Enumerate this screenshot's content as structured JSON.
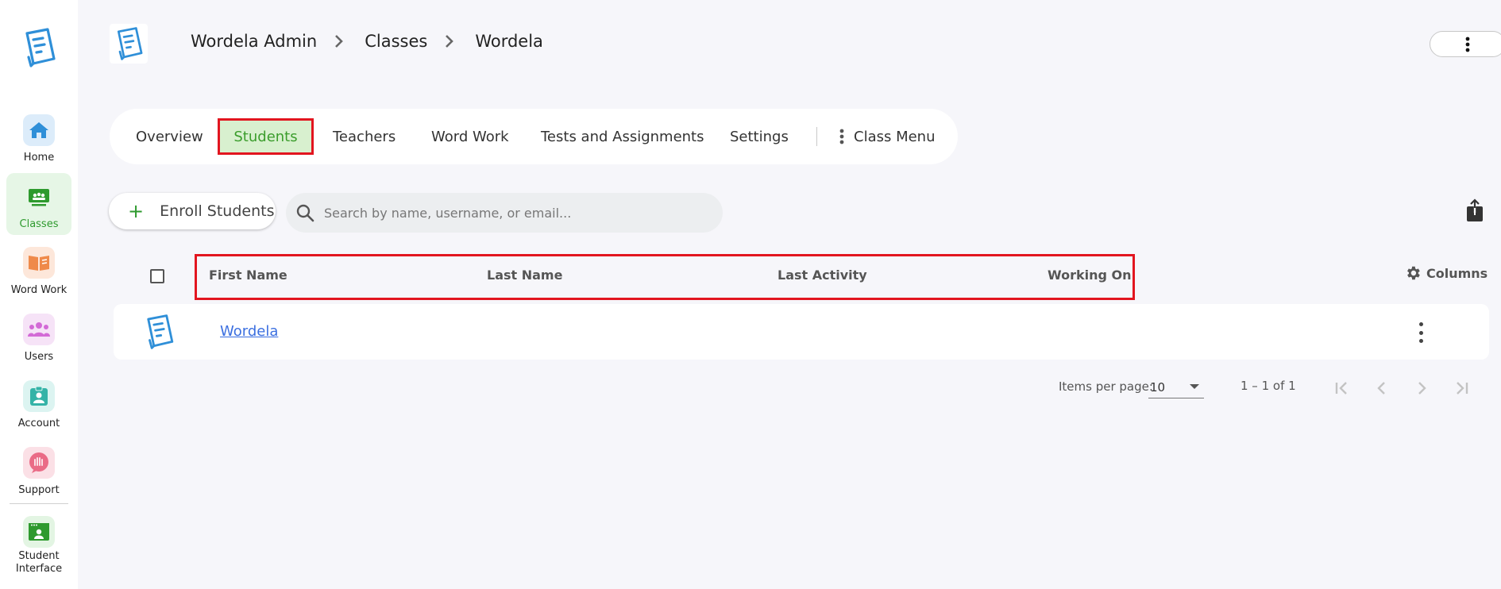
{
  "sidebar": {
    "items": [
      {
        "label": "Home",
        "icon": "home-icon",
        "color": "#2f8fd8",
        "bg": "#dcecfa"
      },
      {
        "label": "Classes",
        "icon": "classroom-icon",
        "color": "#2e9a2e",
        "bg": "#e6f6e6",
        "active": true
      },
      {
        "label": "Word Work",
        "icon": "book-icon",
        "color": "#ef8a4a",
        "bg": "#fde7da"
      },
      {
        "label": "Users",
        "icon": "users-icon",
        "color": "#d36ad6",
        "bg": "#f6e3f7"
      },
      {
        "label": "Account",
        "icon": "id-badge-icon",
        "color": "#34b3a7",
        "bg": "#dcf4f1"
      },
      {
        "label": "Support",
        "icon": "support-bubble-icon",
        "color": "#ea6b86",
        "bg": "#fbe0e6"
      },
      {
        "label": "Student Interface",
        "icon": "student-window-icon",
        "color": "#2e9a2e",
        "bg": "#e3f5e3"
      }
    ]
  },
  "header": {
    "breadcrumb": [
      "Wordela Admin",
      "Classes",
      "Wordela"
    ]
  },
  "tabs": [
    {
      "label": "Overview"
    },
    {
      "label": "Students",
      "active": true
    },
    {
      "label": "Teachers"
    },
    {
      "label": "Word Work"
    },
    {
      "label": "Tests and Assignments"
    },
    {
      "label": "Settings"
    },
    {
      "label": "Class Menu"
    }
  ],
  "toolbar": {
    "enroll_label": "Enroll Students",
    "search_placeholder": "Search by name, username, or email..."
  },
  "table": {
    "columns": [
      "First Name",
      "Last Name",
      "Last Activity",
      "Working On"
    ],
    "columns_button": "Columns",
    "rows": [
      {
        "first_name": "Wordela",
        "last_name": "",
        "last_activity": "",
        "working_on": ""
      }
    ]
  },
  "pagination": {
    "items_per_page_label": "Items per page:",
    "items_per_page": "10",
    "range": "1 – 1 of 1"
  },
  "colors": {
    "accent_green": "#2e9a2e",
    "highlight_red": "#e2151f",
    "link_blue": "#3b6fe0",
    "logo_blue": "#2f8fd8"
  }
}
